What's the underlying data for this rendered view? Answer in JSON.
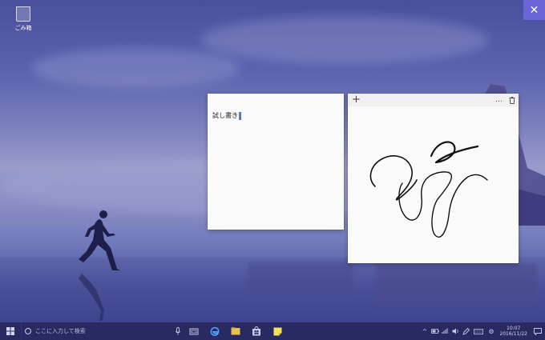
{
  "desktop": {
    "recycle_bin_label": "ごみ箱",
    "corner_button_icon": "close-icon"
  },
  "notes": [
    {
      "type": "text",
      "text": "試し書き"
    },
    {
      "type": "ink",
      "header": {
        "add_icon": "plus-icon",
        "more_label": "…",
        "delete_icon": "trash-icon"
      }
    }
  ],
  "taskbar": {
    "search_placeholder": "ここに入力して検索",
    "apps": [
      "task-view-icon",
      "edge-icon",
      "file-explorer-icon",
      "store-icon",
      "sticky-notes-icon"
    ],
    "tray": [
      "chevron-up-icon",
      "battery-icon",
      "network-icon",
      "volume-icon",
      "pen-icon",
      "keyboard-icon"
    ],
    "clock_time": "10:07",
    "clock_date": "2016/11/22"
  },
  "colors": {
    "taskbar": "#2a2a63",
    "accent": "#6b65d8",
    "note_bg": "#fafafa"
  }
}
